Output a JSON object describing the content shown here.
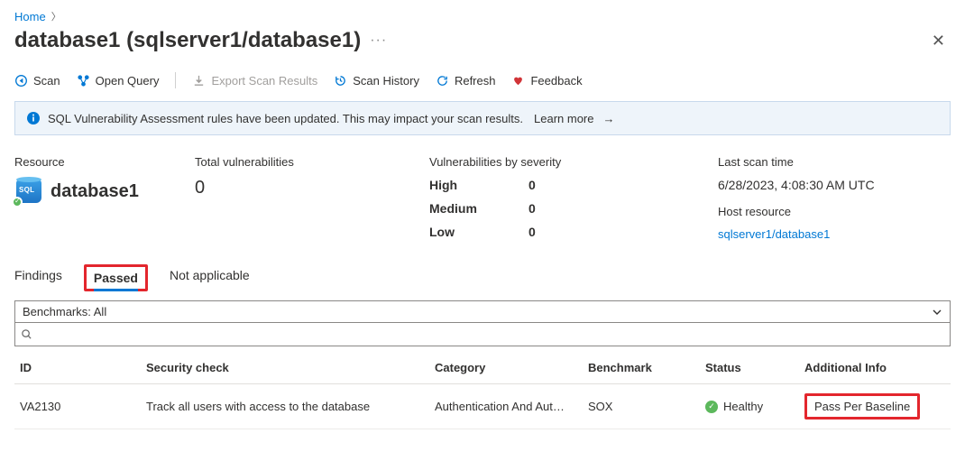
{
  "breadcrumb": {
    "home": "Home"
  },
  "page": {
    "title": "database1 (sqlserver1/database1)"
  },
  "toolbar": {
    "scan": "Scan",
    "open_query": "Open Query",
    "export": "Export Scan Results",
    "history": "Scan History",
    "refresh": "Refresh",
    "feedback": "Feedback"
  },
  "banner": {
    "text": "SQL Vulnerability Assessment rules have been updated. This may impact your scan results.",
    "learn_more": "Learn more"
  },
  "summary": {
    "resource_label": "Resource",
    "resource_name": "database1",
    "total_label": "Total vulnerabilities",
    "total_value": "0",
    "severity_label": "Vulnerabilities by severity",
    "sev": {
      "high_label": "High",
      "high_val": "0",
      "med_label": "Medium",
      "med_val": "0",
      "low_label": "Low",
      "low_val": "0"
    },
    "last_scan_label": "Last scan time",
    "last_scan_value": "6/28/2023, 4:08:30 AM UTC",
    "host_label": "Host resource",
    "host_link": "sqlserver1/database1"
  },
  "tabs": {
    "findings": "Findings",
    "passed": "Passed",
    "na": "Not applicable",
    "active": "passed"
  },
  "filters": {
    "benchmarks": "Benchmarks: All",
    "search_placeholder": ""
  },
  "table": {
    "headers": {
      "id": "ID",
      "check": "Security check",
      "category": "Category",
      "benchmark": "Benchmark",
      "status": "Status",
      "addl": "Additional Info"
    },
    "rows": [
      {
        "id": "VA2130",
        "check": "Track all users with access to the database",
        "category": "Authentication And Aut…",
        "benchmark": "SOX",
        "status": "Healthy",
        "addl": "Pass Per Baseline"
      }
    ]
  }
}
